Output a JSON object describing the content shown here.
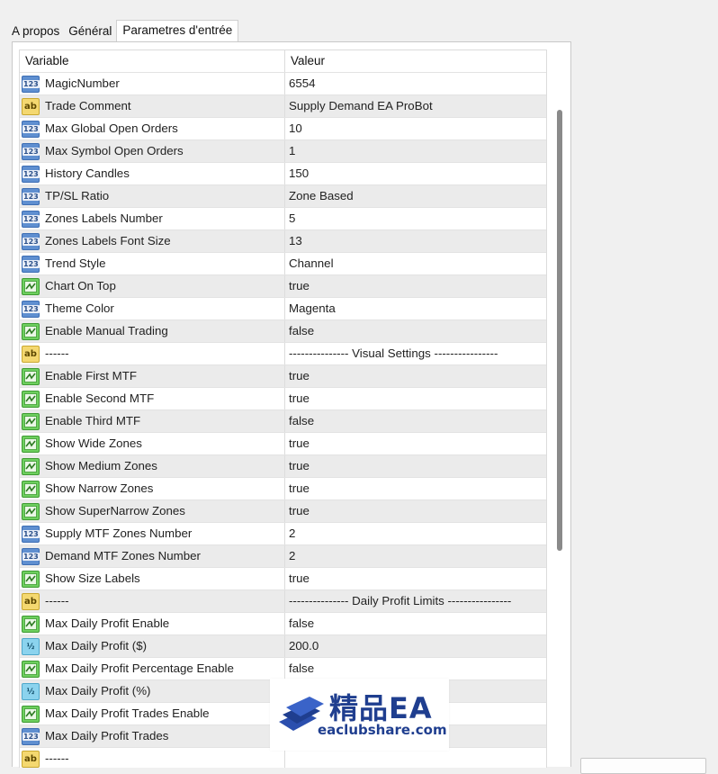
{
  "tabs": [
    {
      "label": "A propos",
      "active": false
    },
    {
      "label": "Général",
      "active": false
    },
    {
      "label": "Parametres d'entrée",
      "active": true
    }
  ],
  "table": {
    "columns": [
      "Variable",
      "Valeur"
    ],
    "rows": [
      {
        "type": "num",
        "variable": "MagicNumber",
        "value": "6554"
      },
      {
        "type": "text",
        "variable": "Trade Comment",
        "value": "Supply Demand EA ProBot"
      },
      {
        "type": "num",
        "variable": "Max Global Open Orders",
        "value": "10"
      },
      {
        "type": "num",
        "variable": "Max Symbol Open Orders",
        "value": "1"
      },
      {
        "type": "num",
        "variable": "History Candles",
        "value": "150"
      },
      {
        "type": "num",
        "variable": "TP/SL Ratio",
        "value": "Zone Based"
      },
      {
        "type": "num",
        "variable": "Zones Labels Number",
        "value": "5"
      },
      {
        "type": "num",
        "variable": "Zones Labels Font Size",
        "value": "13"
      },
      {
        "type": "num",
        "variable": "Trend Style",
        "value": "Channel"
      },
      {
        "type": "bool",
        "variable": "Chart On Top",
        "value": "true"
      },
      {
        "type": "num",
        "variable": "Theme Color",
        "value": "Magenta"
      },
      {
        "type": "bool",
        "variable": "Enable Manual Trading",
        "value": "false"
      },
      {
        "type": "text",
        "variable": "------",
        "value": "--------------- Visual Settings ----------------"
      },
      {
        "type": "bool",
        "variable": "Enable First MTF",
        "value": "true"
      },
      {
        "type": "bool",
        "variable": "Enable Second MTF",
        "value": "true"
      },
      {
        "type": "bool",
        "variable": "Enable Third MTF",
        "value": "false"
      },
      {
        "type": "bool",
        "variable": "Show Wide Zones",
        "value": "true"
      },
      {
        "type": "bool",
        "variable": "Show Medium Zones",
        "value": "true"
      },
      {
        "type": "bool",
        "variable": "Show Narrow Zones",
        "value": "true"
      },
      {
        "type": "bool",
        "variable": "Show SuperNarrow Zones",
        "value": "true"
      },
      {
        "type": "num",
        "variable": "Supply MTF Zones Number",
        "value": "2"
      },
      {
        "type": "num",
        "variable": "Demand MTF Zones Number",
        "value": "2"
      },
      {
        "type": "bool",
        "variable": "Show Size Labels",
        "value": "true"
      },
      {
        "type": "text",
        "variable": "------",
        "value": "--------------- Daily Profit Limits ----------------"
      },
      {
        "type": "bool",
        "variable": "Max Daily Profit Enable",
        "value": "false"
      },
      {
        "type": "frac",
        "variable": "Max Daily Profit ($)",
        "value": "200.0"
      },
      {
        "type": "bool",
        "variable": "Max Daily Profit Percentage Enable",
        "value": "false"
      },
      {
        "type": "frac",
        "variable": "Max Daily Profit (%)",
        "value": ""
      },
      {
        "type": "bool",
        "variable": "Max Daily Profit Trades Enable",
        "value": ""
      },
      {
        "type": "num",
        "variable": "Max Daily Profit Trades",
        "value": ""
      },
      {
        "type": "text",
        "variable": "------",
        "value": ""
      }
    ]
  },
  "icons": {
    "num": {
      "name": "integer-type-icon",
      "glyph": "123",
      "color": "#5f8fd0"
    },
    "text": {
      "name": "string-type-icon",
      "glyph": "ab",
      "color": "#f4d870"
    },
    "bool": {
      "name": "boolean-type-icon",
      "glyph": "",
      "color": "#6ecf5f"
    },
    "frac": {
      "name": "double-type-icon",
      "glyph": "½",
      "color": "#8bd3ee"
    }
  },
  "watermark": {
    "title": "精品EA",
    "url": "eaclubshare.com",
    "color": "#1f3e8f"
  }
}
